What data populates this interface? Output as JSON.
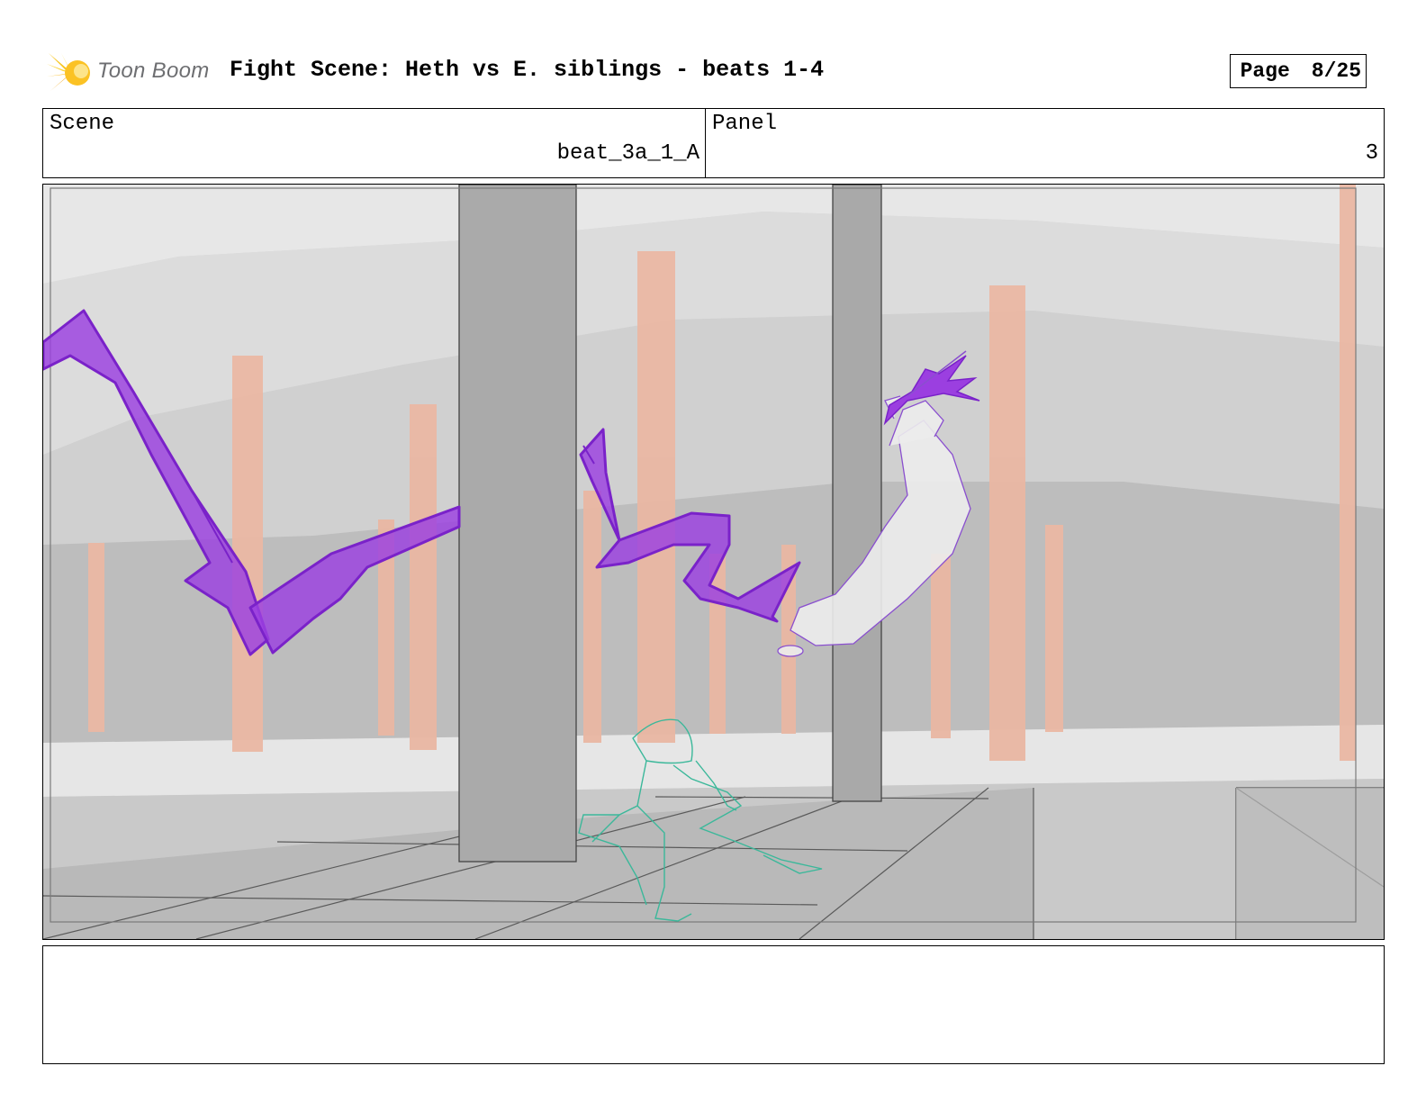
{
  "header": {
    "logo_text": "Toon Boom",
    "title": "Fight Scene: Heth vs E. siblings - beats 1-4",
    "page_label": "Page",
    "page_value": "8/25"
  },
  "info": {
    "scene_label": "Scene",
    "scene_value": "beat_3a_1_A",
    "panel_label": "Panel",
    "panel_value": "3"
  },
  "panel_image": {
    "icon": "storyboard-sketch",
    "colors": {
      "effect": "#9b3fe0",
      "crouching_character": "#3bb89a",
      "flying_character": "#8a4fcf",
      "pillars": "#eab7a3"
    }
  },
  "notes": {
    "text": ""
  }
}
